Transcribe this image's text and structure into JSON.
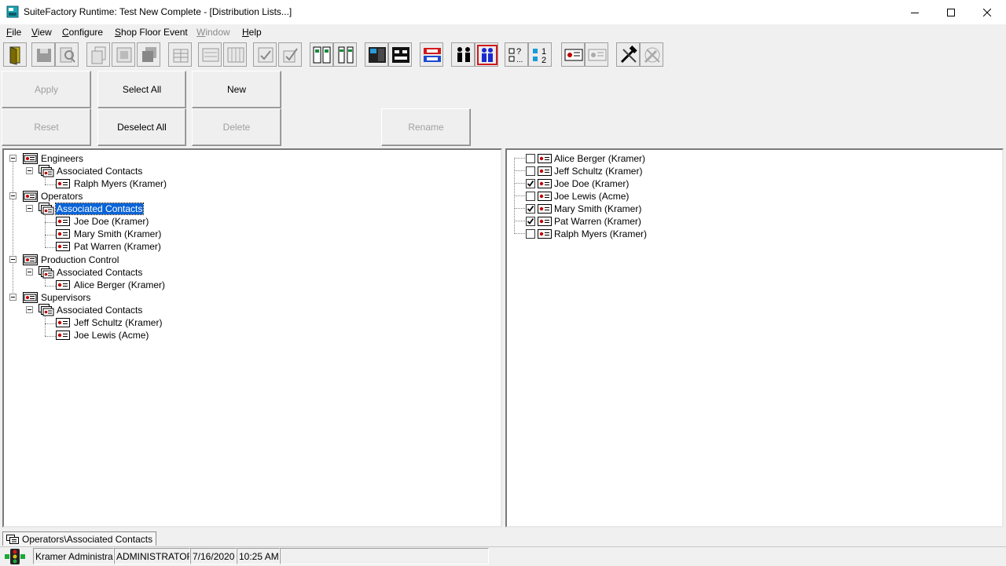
{
  "window": {
    "title": "SuiteFactory Runtime: Test New Complete - [Distribution Lists...]"
  },
  "menu": [
    {
      "label": "File",
      "underline": "F",
      "rest": "ile",
      "disabled": false
    },
    {
      "label": "View",
      "underline": "V",
      "rest": "iew",
      "disabled": false
    },
    {
      "label": "Configure",
      "underline": "C",
      "rest": "onfigure",
      "disabled": false
    },
    {
      "label": "Shop Floor Event",
      "underline": "S",
      "rest": "hop Floor Event",
      "disabled": false
    },
    {
      "label": "Window",
      "underline": "W",
      "rest": "indow",
      "disabled": true
    },
    {
      "label": "Help",
      "underline": "H",
      "rest": "elp",
      "disabled": false
    }
  ],
  "toolbar": {
    "icons": [
      "exit-door-icon",
      "save-icon",
      "find-icon",
      "copy-icon",
      "properties-icon",
      "stack-icon",
      "grid-icon",
      "list-icon",
      "columns-icon",
      "check-doc-icon",
      "check-doc-2-icon",
      "rack-icon",
      "rack-2-icon",
      "panel-icon",
      "bracket-icon",
      "network-icon",
      "users-icon",
      "users-red-icon",
      "question-list-icon",
      "numbered-list-icon",
      "id-card-icon",
      "id-card-2-icon",
      "tools-icon",
      "tools-disabled-icon"
    ]
  },
  "actions": {
    "apply": "Apply",
    "select_all": "Select All",
    "new": "New",
    "reset": "Reset",
    "deselect_all": "Deselect All",
    "delete": "Delete",
    "rename": "Rename"
  },
  "left_tree": {
    "nodes": [
      {
        "label": "Engineers",
        "level": 0,
        "icon": "group-list-icon"
      },
      {
        "label": "Associated Contacts",
        "level": 1,
        "icon": "contacts-icon"
      },
      {
        "label": "Ralph Myers (Kramer)",
        "level": 2,
        "icon": "contact-card-icon"
      },
      {
        "label": "Operators",
        "level": 0,
        "icon": "group-list-icon"
      },
      {
        "label": "Associated Contacts",
        "level": 1,
        "icon": "contacts-icon",
        "selected": true
      },
      {
        "label": "Joe Doe (Kramer)",
        "level": 2,
        "icon": "contact-card-icon"
      },
      {
        "label": "Mary Smith (Kramer)",
        "level": 2,
        "icon": "contact-card-icon"
      },
      {
        "label": "Pat Warren (Kramer)",
        "level": 2,
        "icon": "contact-card-icon"
      },
      {
        "label": "Production Control",
        "level": 0,
        "icon": "group-list-icon"
      },
      {
        "label": "Associated Contacts",
        "level": 1,
        "icon": "contacts-icon"
      },
      {
        "label": "Alice Berger (Kramer)",
        "level": 2,
        "icon": "contact-card-icon"
      },
      {
        "label": "Supervisors",
        "level": 0,
        "icon": "group-list-icon"
      },
      {
        "label": "Associated Contacts",
        "level": 1,
        "icon": "contacts-icon"
      },
      {
        "label": "Jeff Schultz (Kramer)",
        "level": 2,
        "icon": "contact-card-icon"
      },
      {
        "label": "Joe Lewis (Acme)",
        "level": 2,
        "icon": "contact-card-icon"
      }
    ]
  },
  "right_list": {
    "items": [
      {
        "label": "Alice Berger (Kramer)",
        "checked": false
      },
      {
        "label": "Jeff Schultz (Kramer)",
        "checked": false
      },
      {
        "label": "Joe Doe (Kramer)",
        "checked": true
      },
      {
        "label": "Joe Lewis (Acme)",
        "checked": false
      },
      {
        "label": "Mary Smith (Kramer)",
        "checked": true
      },
      {
        "label": "Pat Warren (Kramer)",
        "checked": true
      },
      {
        "label": "Ralph Myers (Kramer)",
        "checked": false
      }
    ]
  },
  "path_tab": {
    "label": "Operators\\Associated Contacts"
  },
  "status": {
    "user": "Kramer Administrator",
    "role": "ADMINISTRATOR",
    "date": "7/16/2020",
    "time": "10:25 AM"
  },
  "colors": {
    "selection": "#0a64d8",
    "contact_icon_red": "#c00000"
  }
}
